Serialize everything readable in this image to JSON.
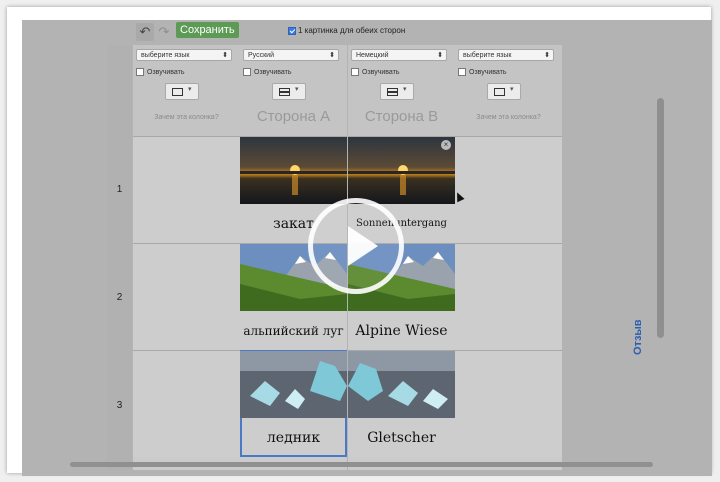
{
  "toolbar": {
    "undo_glyph": "↶",
    "redo_glyph": "↷",
    "save_label": "Сохранить",
    "both_sides_label": "1 картинка для обеих сторон",
    "both_sides_checked": true
  },
  "columns": [
    {
      "language": "выберите язык",
      "speak_label": "Озвучивать",
      "layout": "single",
      "footer": "Зачем эта колонка?"
    },
    {
      "language": "Русский",
      "speak_label": "Озвучивать",
      "layout": "split",
      "footer": "Сторона А"
    },
    {
      "language": "Немецкий",
      "speak_label": "Озвучивать",
      "layout": "split",
      "footer": "Сторона В"
    },
    {
      "language": "выберите язык",
      "speak_label": "Озвучивать",
      "layout": "single",
      "footer": "Зачем эта колонка?"
    }
  ],
  "rows": [
    {
      "number": "1",
      "side_a": "закат",
      "side_b": "Sonnenuntergang",
      "image": "sunset-lake"
    },
    {
      "number": "2",
      "side_a": "альпийский луг",
      "side_b": "Alpine Wiese",
      "image": "alpine-meadow"
    },
    {
      "number": "3",
      "side_a": "ледник",
      "side_b": "Gletscher",
      "image": "glacier-ice"
    }
  ],
  "feedback_label": "Отзыв",
  "delete_glyph": "×",
  "caret_glyph": "▾",
  "select_arrow_glyph": "⬍",
  "colors": {
    "save": "#5c9a56",
    "selection": "#4a79c6",
    "feedback": "#2c5fb3"
  }
}
